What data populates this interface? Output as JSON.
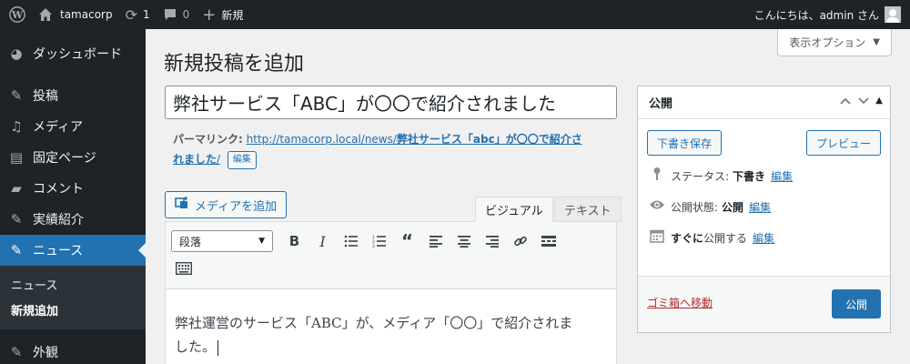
{
  "adminbar": {
    "site_name": "tamacorp",
    "updates_count": "1",
    "comments_count": "0",
    "new_label": "新規",
    "greeting": "こんにちは、admin さん"
  },
  "sidebar": {
    "items": [
      {
        "label": "ダッシュボード",
        "icon": "dashboard-icon"
      },
      {
        "label": "投稿",
        "icon": "pin-icon"
      },
      {
        "label": "メディア",
        "icon": "media-icon"
      },
      {
        "label": "固定ページ",
        "icon": "pages-icon"
      },
      {
        "label": "コメント",
        "icon": "comments-icon"
      },
      {
        "label": "実績紹介",
        "icon": "pin-icon"
      },
      {
        "label": "ニュース",
        "icon": "pin-icon"
      },
      {
        "label": "外観",
        "icon": "appearance-icon"
      }
    ],
    "submenu": [
      {
        "label": "ニュース"
      },
      {
        "label": "新規追加"
      }
    ]
  },
  "main": {
    "screen_options": "表示オプション",
    "page_title": "新規投稿を追加",
    "post_title": "弊社サービス「ABC」が〇〇で紹介されました",
    "permalink": {
      "label": "パーマリンク:",
      "url_base": "http://tamacorp.local/news/",
      "slug": "弊社サービス「abc」が〇〇で紹介さ",
      "slug_cont": "れました",
      "slug_suffix": "/",
      "edit_button": "編集"
    },
    "add_media": "メディアを追加",
    "tabs": {
      "visual": "ビジュアル",
      "text": "テキスト"
    },
    "format_select": "段落",
    "content_line1": "弊社運営のサービス「ABC」が、メディア「〇〇」で紹介されま",
    "content_line2": "した。"
  },
  "publish": {
    "title": "公開",
    "save_draft": "下書き保存",
    "preview": "プレビュー",
    "status_label": "ステータス:",
    "status_value": "下書き",
    "visibility_label": "公開状態:",
    "visibility_value": "公開",
    "schedule_prefix": "すぐに",
    "schedule_suffix": "公開する",
    "edit_link": "編集",
    "trash": "ゴミ箱へ移動",
    "publish_button": "公開"
  },
  "colors": {
    "accent": "#2271b1",
    "adminbar_bg": "#1d2327",
    "trash": "#b32d2e"
  }
}
